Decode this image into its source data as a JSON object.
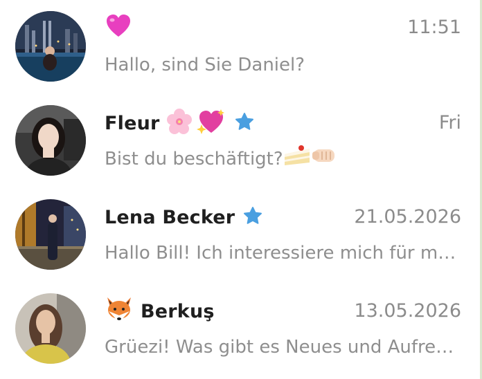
{
  "chats": [
    {
      "name": "",
      "name_emojis": [
        "heart-icon"
      ],
      "verified": false,
      "time": "11:51",
      "preview": "Hallo, sind Sie Daniel?"
    },
    {
      "name": "Fleur",
      "name_emojis": [
        "cherry-blossom-icon",
        "sparkling-heart-icon"
      ],
      "verified": true,
      "time": "Fri",
      "preview": "Bist du beschäftigt?",
      "preview_emojis": [
        "cake-icon",
        "fist-icon"
      ]
    },
    {
      "name": "Lena Becker",
      "verified": true,
      "time": "21.05.2026",
      "preview": "Hallo Bill! Ich interessiere mich für mo..."
    },
    {
      "name": "Berkuş",
      "prefix_emoji": "fox-icon",
      "verified": false,
      "time": "13.05.2026",
      "preview": "Grüezi! Was gibt es Neues und Aufreg..."
    }
  ],
  "colors": {
    "name": "#1f1f1f",
    "secondary": "#8e8e8e",
    "verified": "#4a9fe0",
    "edge": "#d9e8cf"
  }
}
